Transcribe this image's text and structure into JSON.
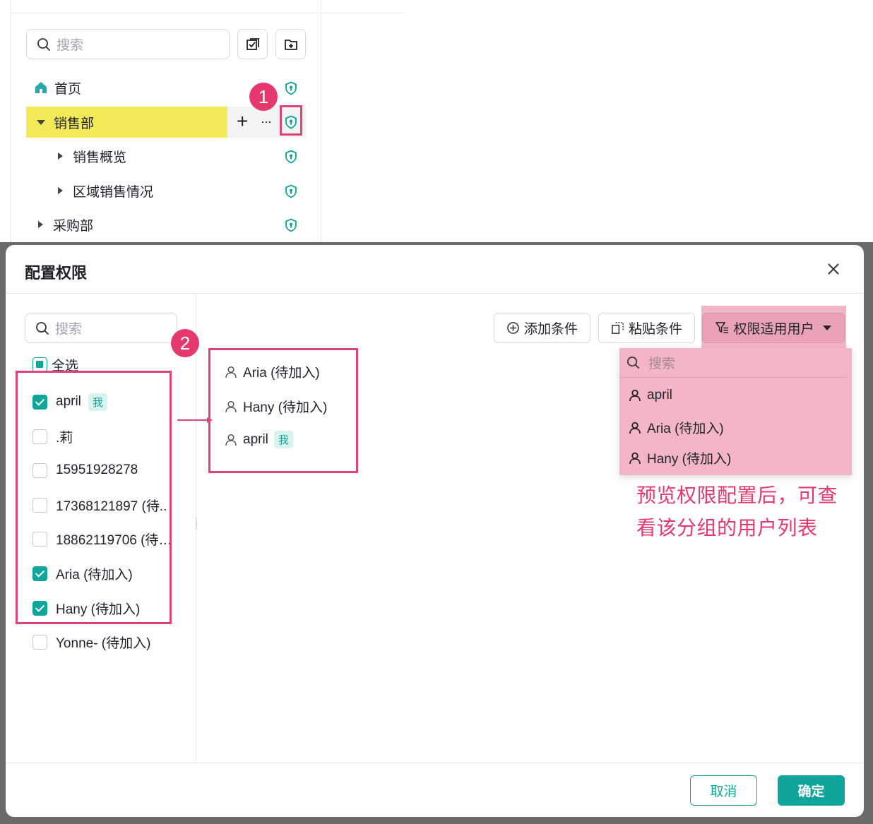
{
  "tree": {
    "search_placeholder": "搜索",
    "items": [
      {
        "label": "首页"
      },
      {
        "label": "销售部"
      },
      {
        "label": "销售概览"
      },
      {
        "label": "区域销售情况"
      },
      {
        "label": "采购部"
      }
    ],
    "row_actions": {
      "add": "+",
      "more": "···"
    }
  },
  "annotations": {
    "step1": "1",
    "step2": "2",
    "note_line1": "预览权限配置后，可查",
    "note_line2": "看该分组的用户列表"
  },
  "dialog": {
    "title": "配置权限",
    "search_placeholder": "搜索",
    "select_all": "全选",
    "me_tag": "我",
    "users": [
      {
        "name": "april",
        "checked": true,
        "me": true
      },
      {
        "name": ".莉",
        "checked": false
      },
      {
        "name": "15951928278",
        "checked": false
      },
      {
        "name": "17368121897 (待..",
        "checked": false
      },
      {
        "name": "18862119706 (待…",
        "checked": false
      },
      {
        "name": "Aria (待加入)",
        "checked": true
      },
      {
        "name": "Hany (待加入)",
        "checked": true
      },
      {
        "name": "Yonne- (待加入)",
        "checked": false
      }
    ],
    "selected": [
      {
        "name": "Aria (待加入)"
      },
      {
        "name": "Hany (待加入)"
      },
      {
        "name": "april",
        "me": true
      }
    ],
    "toolbar": {
      "add_condition": "添加条件",
      "paste_condition": "粘贴条件",
      "applicable_users": "权限适用用户"
    },
    "dropdown": {
      "search_placeholder": "搜索",
      "users": [
        "april",
        "Aria (待加入)",
        "Hany (待加入)"
      ]
    },
    "footer": {
      "cancel": "取消",
      "confirm": "确定"
    }
  },
  "colors": {
    "accent": "#0ea59a",
    "annotation": "#e5396d",
    "highlight_yellow": "#f2ea57",
    "highlight_pink": "#f4b6c6"
  }
}
